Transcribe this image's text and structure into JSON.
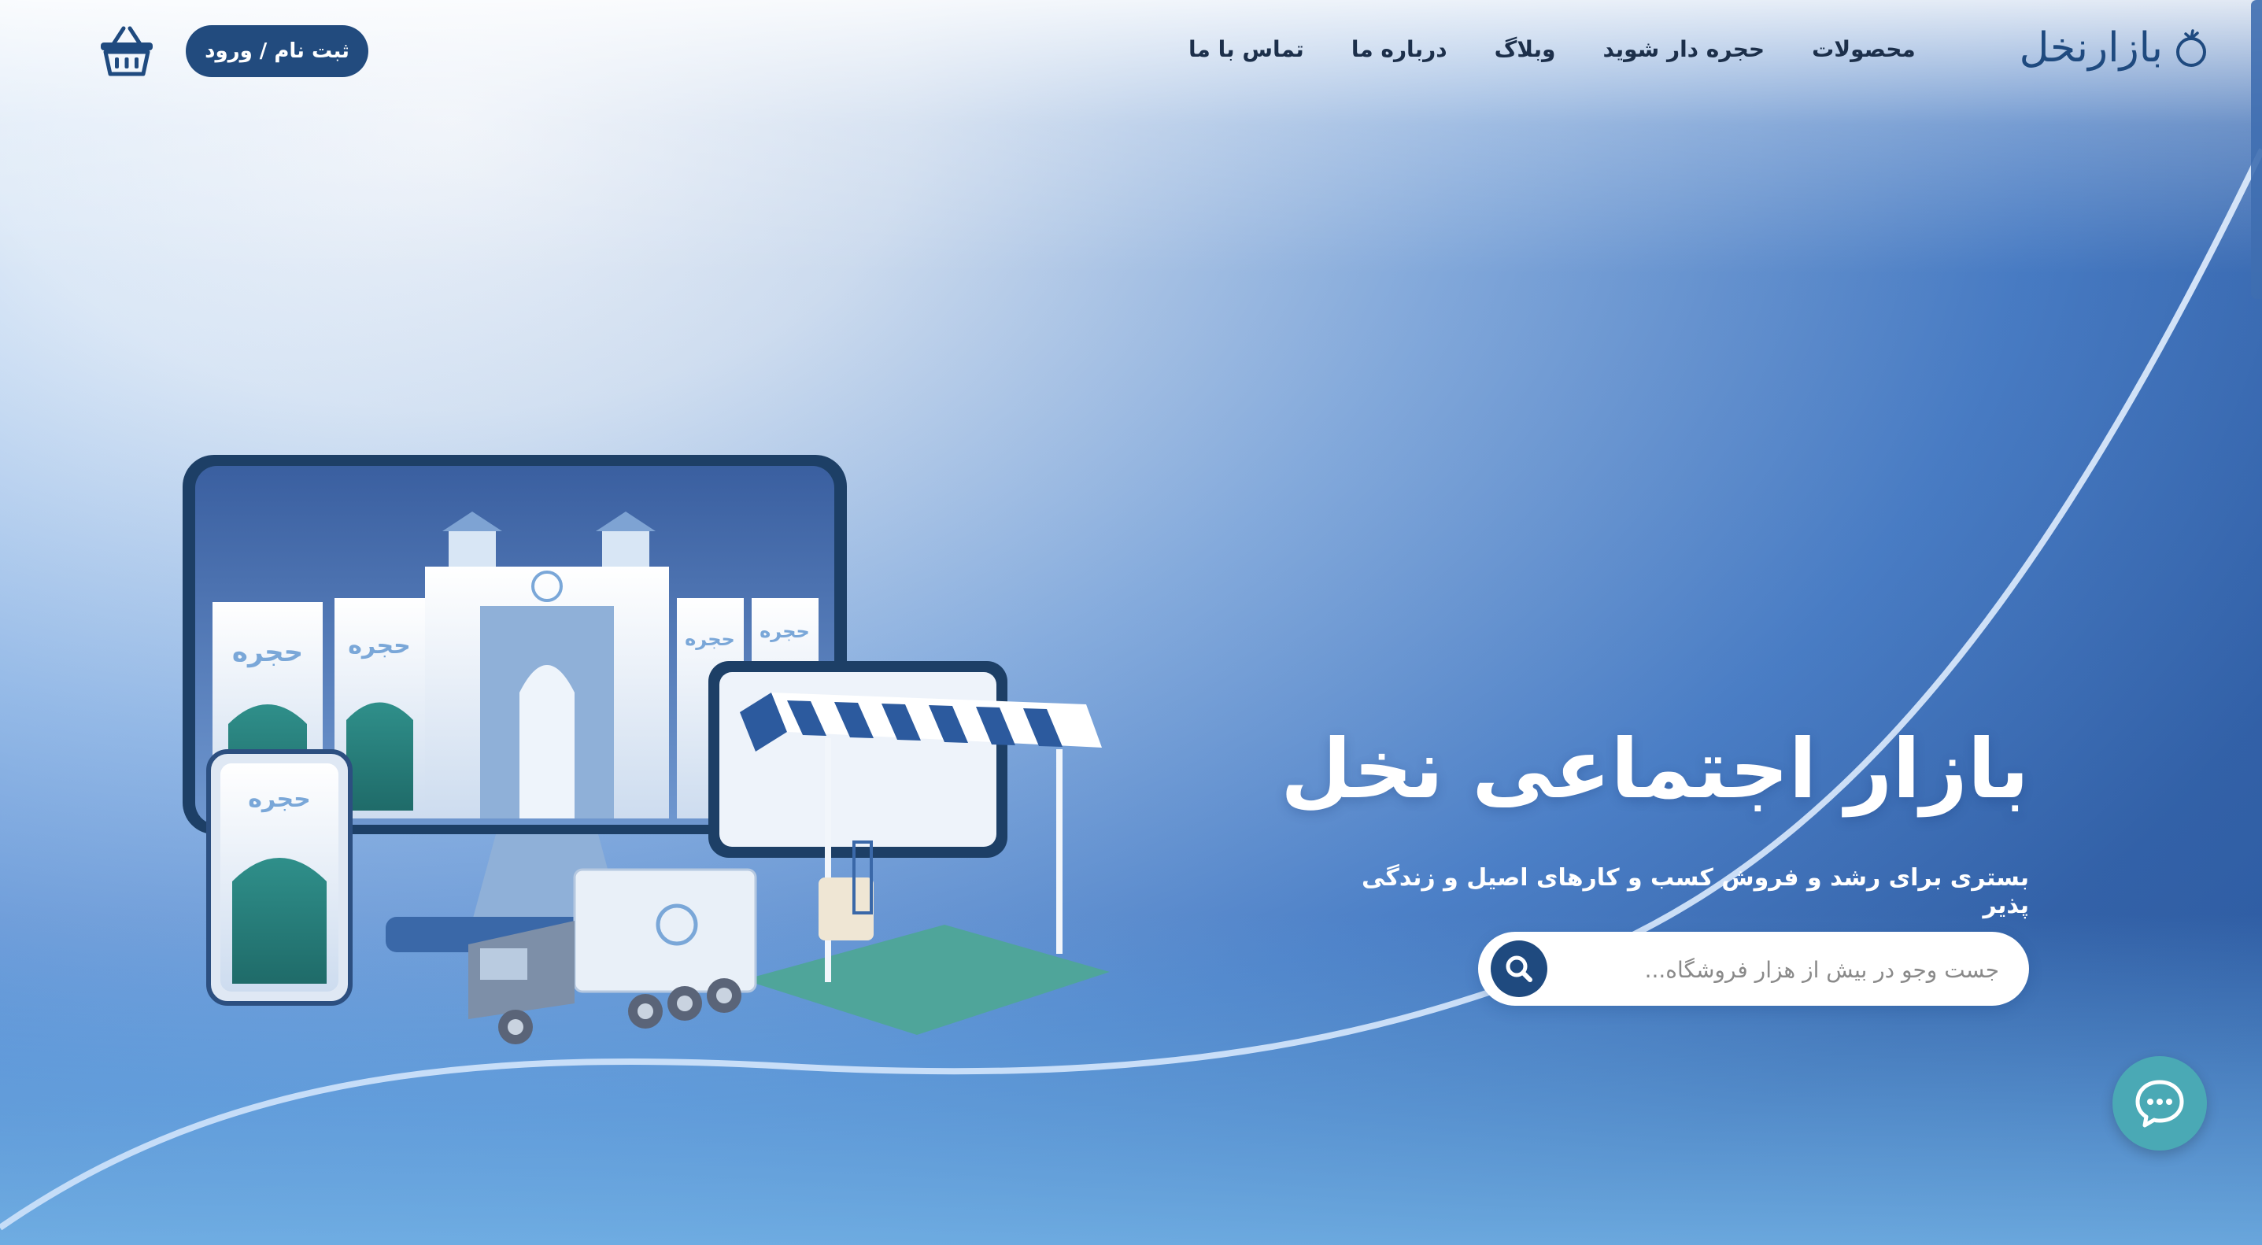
{
  "brand": {
    "name": "بازارنخل",
    "logo_icon": "palm-drop-icon",
    "primary_color": "#1f4a7f",
    "accent_color": "#4aa9b5"
  },
  "nav": {
    "items": [
      {
        "label": "محصولات"
      },
      {
        "label": "حجره دار شوید"
      },
      {
        "label": "وبلاگ"
      },
      {
        "label": "درباره ما"
      },
      {
        "label": "تماس با ما"
      }
    ]
  },
  "header": {
    "auth_label": "ثبت نام / ورود",
    "cart_icon": "shopping-basket-icon"
  },
  "hero": {
    "title": "بازار اجتماعی نخل",
    "subtitle": "بستری برای رشد و فروش کسب و کارهای اصیل و زندگی پذیر",
    "search_placeholder": "جست وجو در بیش از هزار فروشگاه...",
    "search_icon": "search-icon"
  },
  "illustration": {
    "booth_label": "حجره"
  },
  "chat": {
    "icon": "chat-bubble-icon"
  }
}
